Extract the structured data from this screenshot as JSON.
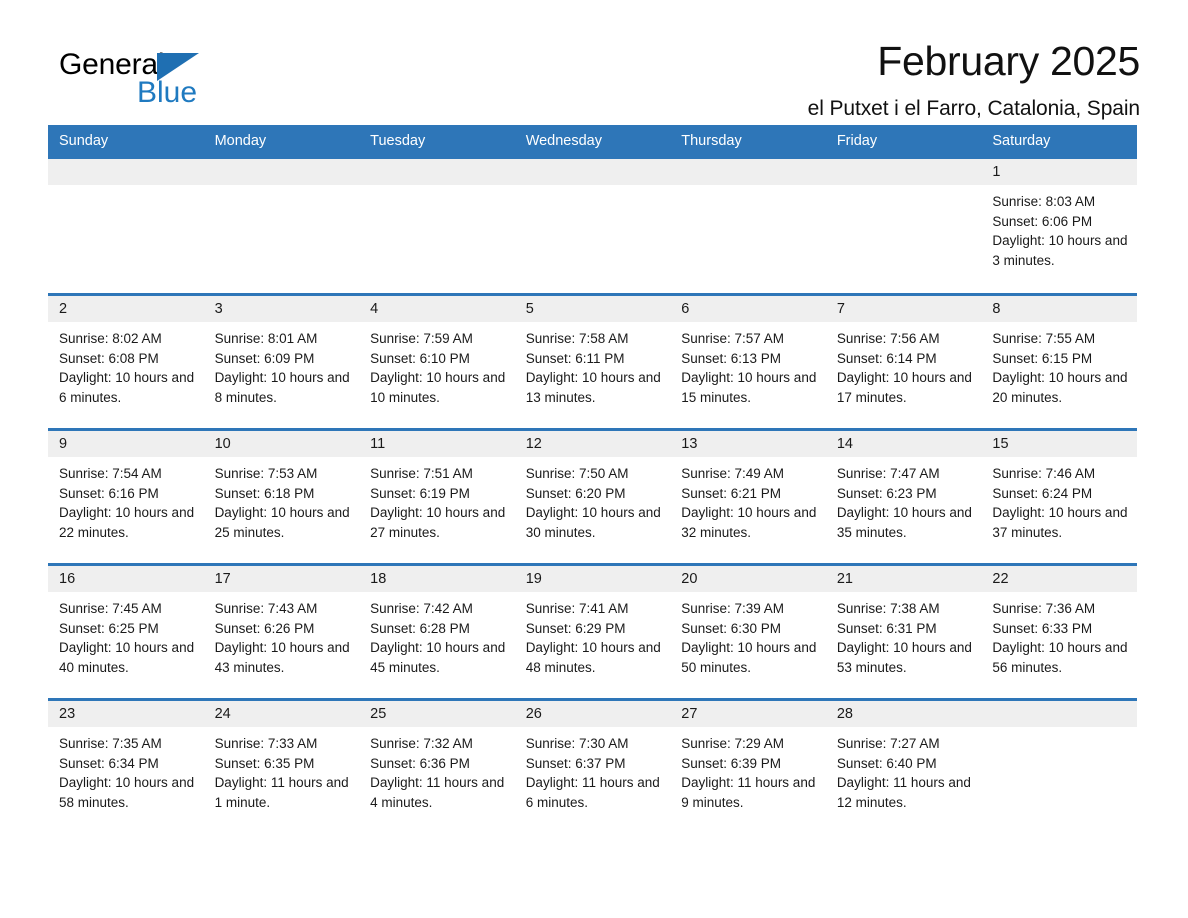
{
  "brand": {
    "name_part1": "General",
    "name_part2": "Blue",
    "accent_color": "#2e76b8",
    "logo_blue": "#1f7ac0"
  },
  "header": {
    "title": "February 2025",
    "subtitle": "el Putxet i el Farro, Catalonia, Spain"
  },
  "calendar": {
    "weekday_headers": [
      "Sunday",
      "Monday",
      "Tuesday",
      "Wednesday",
      "Thursday",
      "Friday",
      "Saturday"
    ],
    "weeks": [
      [
        {
          "day": "",
          "sunrise": "",
          "sunset": "",
          "daylight": ""
        },
        {
          "day": "",
          "sunrise": "",
          "sunset": "",
          "daylight": ""
        },
        {
          "day": "",
          "sunrise": "",
          "sunset": "",
          "daylight": ""
        },
        {
          "day": "",
          "sunrise": "",
          "sunset": "",
          "daylight": ""
        },
        {
          "day": "",
          "sunrise": "",
          "sunset": "",
          "daylight": ""
        },
        {
          "day": "",
          "sunrise": "",
          "sunset": "",
          "daylight": ""
        },
        {
          "day": "1",
          "sunrise": "Sunrise: 8:03 AM",
          "sunset": "Sunset: 6:06 PM",
          "daylight": "Daylight: 10 hours and 3 minutes."
        }
      ],
      [
        {
          "day": "2",
          "sunrise": "Sunrise: 8:02 AM",
          "sunset": "Sunset: 6:08 PM",
          "daylight": "Daylight: 10 hours and 6 minutes."
        },
        {
          "day": "3",
          "sunrise": "Sunrise: 8:01 AM",
          "sunset": "Sunset: 6:09 PM",
          "daylight": "Daylight: 10 hours and 8 minutes."
        },
        {
          "day": "4",
          "sunrise": "Sunrise: 7:59 AM",
          "sunset": "Sunset: 6:10 PM",
          "daylight": "Daylight: 10 hours and 10 minutes."
        },
        {
          "day": "5",
          "sunrise": "Sunrise: 7:58 AM",
          "sunset": "Sunset: 6:11 PM",
          "daylight": "Daylight: 10 hours and 13 minutes."
        },
        {
          "day": "6",
          "sunrise": "Sunrise: 7:57 AM",
          "sunset": "Sunset: 6:13 PM",
          "daylight": "Daylight: 10 hours and 15 minutes."
        },
        {
          "day": "7",
          "sunrise": "Sunrise: 7:56 AM",
          "sunset": "Sunset: 6:14 PM",
          "daylight": "Daylight: 10 hours and 17 minutes."
        },
        {
          "day": "8",
          "sunrise": "Sunrise: 7:55 AM",
          "sunset": "Sunset: 6:15 PM",
          "daylight": "Daylight: 10 hours and 20 minutes."
        }
      ],
      [
        {
          "day": "9",
          "sunrise": "Sunrise: 7:54 AM",
          "sunset": "Sunset: 6:16 PM",
          "daylight": "Daylight: 10 hours and 22 minutes."
        },
        {
          "day": "10",
          "sunrise": "Sunrise: 7:53 AM",
          "sunset": "Sunset: 6:18 PM",
          "daylight": "Daylight: 10 hours and 25 minutes."
        },
        {
          "day": "11",
          "sunrise": "Sunrise: 7:51 AM",
          "sunset": "Sunset: 6:19 PM",
          "daylight": "Daylight: 10 hours and 27 minutes."
        },
        {
          "day": "12",
          "sunrise": "Sunrise: 7:50 AM",
          "sunset": "Sunset: 6:20 PM",
          "daylight": "Daylight: 10 hours and 30 minutes."
        },
        {
          "day": "13",
          "sunrise": "Sunrise: 7:49 AM",
          "sunset": "Sunset: 6:21 PM",
          "daylight": "Daylight: 10 hours and 32 minutes."
        },
        {
          "day": "14",
          "sunrise": "Sunrise: 7:47 AM",
          "sunset": "Sunset: 6:23 PM",
          "daylight": "Daylight: 10 hours and 35 minutes."
        },
        {
          "day": "15",
          "sunrise": "Sunrise: 7:46 AM",
          "sunset": "Sunset: 6:24 PM",
          "daylight": "Daylight: 10 hours and 37 minutes."
        }
      ],
      [
        {
          "day": "16",
          "sunrise": "Sunrise: 7:45 AM",
          "sunset": "Sunset: 6:25 PM",
          "daylight": "Daylight: 10 hours and 40 minutes."
        },
        {
          "day": "17",
          "sunrise": "Sunrise: 7:43 AM",
          "sunset": "Sunset: 6:26 PM",
          "daylight": "Daylight: 10 hours and 43 minutes."
        },
        {
          "day": "18",
          "sunrise": "Sunrise: 7:42 AM",
          "sunset": "Sunset: 6:28 PM",
          "daylight": "Daylight: 10 hours and 45 minutes."
        },
        {
          "day": "19",
          "sunrise": "Sunrise: 7:41 AM",
          "sunset": "Sunset: 6:29 PM",
          "daylight": "Daylight: 10 hours and 48 minutes."
        },
        {
          "day": "20",
          "sunrise": "Sunrise: 7:39 AM",
          "sunset": "Sunset: 6:30 PM",
          "daylight": "Daylight: 10 hours and 50 minutes."
        },
        {
          "day": "21",
          "sunrise": "Sunrise: 7:38 AM",
          "sunset": "Sunset: 6:31 PM",
          "daylight": "Daylight: 10 hours and 53 minutes."
        },
        {
          "day": "22",
          "sunrise": "Sunrise: 7:36 AM",
          "sunset": "Sunset: 6:33 PM",
          "daylight": "Daylight: 10 hours and 56 minutes."
        }
      ],
      [
        {
          "day": "23",
          "sunrise": "Sunrise: 7:35 AM",
          "sunset": "Sunset: 6:34 PM",
          "daylight": "Daylight: 10 hours and 58 minutes."
        },
        {
          "day": "24",
          "sunrise": "Sunrise: 7:33 AM",
          "sunset": "Sunset: 6:35 PM",
          "daylight": "Daylight: 11 hours and 1 minute."
        },
        {
          "day": "25",
          "sunrise": "Sunrise: 7:32 AM",
          "sunset": "Sunset: 6:36 PM",
          "daylight": "Daylight: 11 hours and 4 minutes."
        },
        {
          "day": "26",
          "sunrise": "Sunrise: 7:30 AM",
          "sunset": "Sunset: 6:37 PM",
          "daylight": "Daylight: 11 hours and 6 minutes."
        },
        {
          "day": "27",
          "sunrise": "Sunrise: 7:29 AM",
          "sunset": "Sunset: 6:39 PM",
          "daylight": "Daylight: 11 hours and 9 minutes."
        },
        {
          "day": "28",
          "sunrise": "Sunrise: 7:27 AM",
          "sunset": "Sunset: 6:40 PM",
          "daylight": "Daylight: 11 hours and 12 minutes."
        },
        {
          "day": "",
          "sunrise": "",
          "sunset": "",
          "daylight": ""
        }
      ]
    ]
  }
}
